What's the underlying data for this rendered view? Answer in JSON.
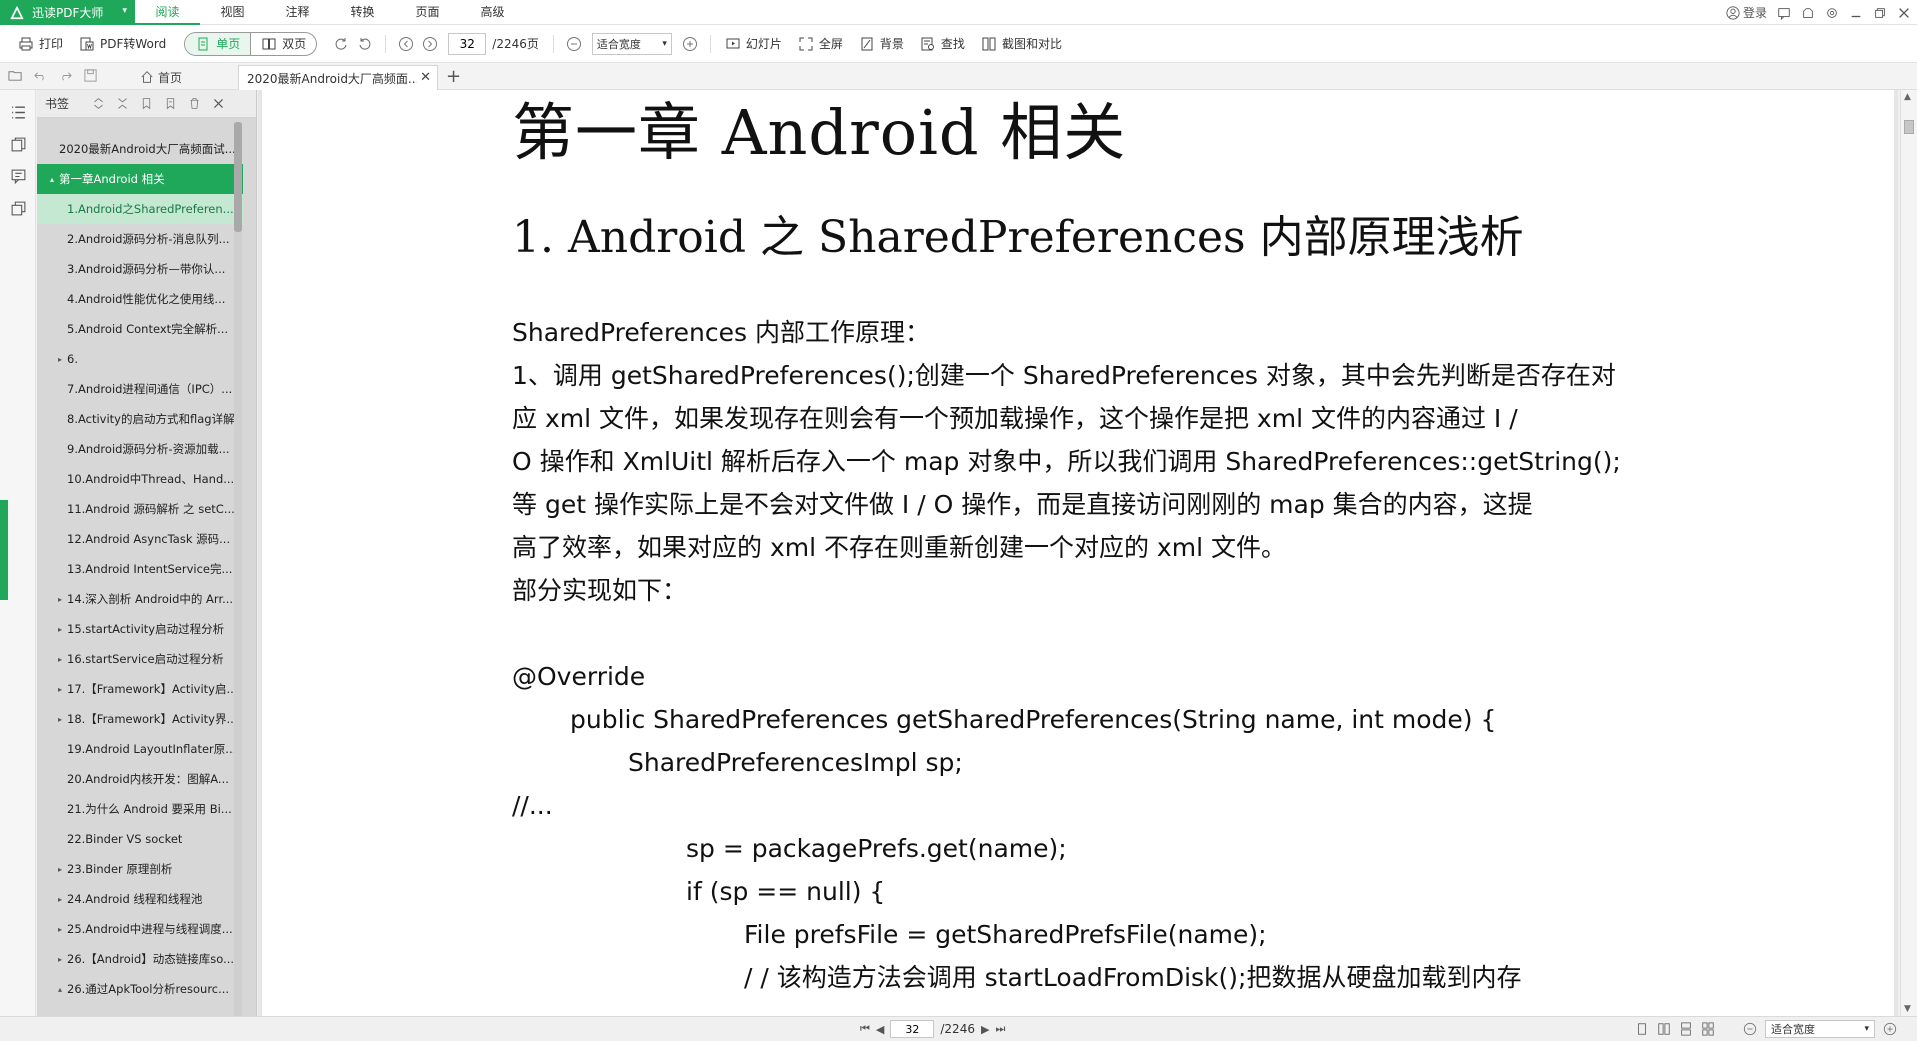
{
  "app": {
    "brand_label": "迅读PDF大师",
    "menu_tabs": [
      "阅读",
      "视图",
      "注释",
      "转换",
      "页面",
      "高级"
    ],
    "active_menu": "阅读",
    "login_label": "登录",
    "accent_color": "#1fa85a"
  },
  "toolbar": {
    "print_label": "打印",
    "pdf_to_word_label": "PDF转Word",
    "single_page_label": "单页",
    "double_page_label": "双页",
    "current_page": "32",
    "total_pages": "/2246页",
    "zoom_value": "适合宽度",
    "slideshow_label": "幻灯片",
    "fullscreen_label": "全屏",
    "background_label": "背景",
    "find_label": "查找",
    "crop_compare_label": "截图和对比"
  },
  "tabs": {
    "home_label": "首页",
    "doc_tab_title": "2020最新Android大厂高频面..."
  },
  "bookmarks": {
    "header_label": "书签",
    "items": [
      {
        "label": "2020最新Android大厂高频面试...",
        "level": 0,
        "arrow": ""
      },
      {
        "label": "第一章Android 相关",
        "level": 0,
        "arrow": "▴"
      },
      {
        "label": "1.Android之SharedPreferen...",
        "level": 1,
        "arrow": ""
      },
      {
        "label": "2.Android源码分析-消息队列...",
        "level": 1,
        "arrow": ""
      },
      {
        "label": "3.Android源码分析—带你认...",
        "level": 1,
        "arrow": ""
      },
      {
        "label": "4.Android性能优化之使用线...",
        "level": 1,
        "arrow": ""
      },
      {
        "label": "5.Android Context完全解析...",
        "level": 1,
        "arrow": ""
      },
      {
        "label": "6.",
        "level": 1,
        "arrow": "▸"
      },
      {
        "label": "7.Android进程间通信（IPC）...",
        "level": 1,
        "arrow": ""
      },
      {
        "label": "8.Activity的启动方式和flag详解",
        "level": 1,
        "arrow": ""
      },
      {
        "label": "9.Android源码分析-资源加载...",
        "level": 1,
        "arrow": ""
      },
      {
        "label": "10.Android中Thread、Hand...",
        "level": 1,
        "arrow": ""
      },
      {
        "label": "11.Android 源码解析 之 setC...",
        "level": 1,
        "arrow": ""
      },
      {
        "label": "12.Android AsyncTask 源码...",
        "level": 1,
        "arrow": ""
      },
      {
        "label": "13.Android IntentService完...",
        "level": 1,
        "arrow": ""
      },
      {
        "label": "14.深入剖析 Android中的 Arr...",
        "level": 1,
        "arrow": "▸"
      },
      {
        "label": "15.startActivity启动过程分析",
        "level": 1,
        "arrow": "▸"
      },
      {
        "label": "16.startService启动过程分析",
        "level": 1,
        "arrow": "▸"
      },
      {
        "label": "17.【Framework】Activity启...",
        "level": 1,
        "arrow": "▸"
      },
      {
        "label": "18.【Framework】Activity界...",
        "level": 1,
        "arrow": "▸"
      },
      {
        "label": "19.Android LayoutInflater原...",
        "level": 1,
        "arrow": ""
      },
      {
        "label": "20.Android内核开发：图解A...",
        "level": 1,
        "arrow": ""
      },
      {
        "label": "21.为什么 Android 要采用 Bi...",
        "level": 1,
        "arrow": ""
      },
      {
        "label": "22.Binder VS socket",
        "level": 1,
        "arrow": ""
      },
      {
        "label": "23.Binder 原理剖析",
        "level": 1,
        "arrow": "▸"
      },
      {
        "label": "24.Android 线程和线程池",
        "level": 1,
        "arrow": "▸"
      },
      {
        "label": "25.Android中进程与线程调度...",
        "level": 1,
        "arrow": "▸"
      },
      {
        "label": "26.【Android】动态链接库so...",
        "level": 1,
        "arrow": "▸"
      },
      {
        "label": "26.通过ApkTool分析resourc...",
        "level": 1,
        "arrow": "▴"
      }
    ]
  },
  "document": {
    "chapter_title": "第一章 Android 相关",
    "section_title": "1. Android 之 SharedPreferences 内部原理浅析",
    "paragraphs": [
      "SharedPreferences 内部工作原理：",
      "1、调用 getSharedPreferences();创建一个 SharedPreferences 对象，其中会先判断是否存在对",
      "应 xml 文件，如果发现存在则会有一个预加载操作，这个操作是把 xml 文件的内容通过 I /",
      "O 操作和 XmlUitl 解析后存入一个 map 对象中，所以我们调用 SharedPreferences::getString();",
      "等 get 操作实际上是不会对文件做 I / O 操作，而是直接访问刚刚的 map 集合的内容，这提",
      "高了效率，如果对应的 xml 不存在则重新创建一个对应的 xml 文件。",
      "部分实现如下："
    ],
    "code": [
      {
        "text": "@Override",
        "indent": 0
      },
      {
        "text": "public SharedPreferences getSharedPreferences(String name, int mode) {",
        "indent": 1
      },
      {
        "text": "SharedPreferencesImpl sp;",
        "indent": 2
      },
      {
        "text": "//...",
        "indent": 0
      },
      {
        "text": "sp = packagePrefs.get(name);",
        "indent": 3
      },
      {
        "text": "if (sp == null) {",
        "indent": 3
      },
      {
        "text": "File prefsFile = getSharedPrefsFile(name);",
        "indent": 4
      },
      {
        "text": "/ / 该构造方法会调用 startLoadFromDisk();把数据从硬盘加载到内存",
        "indent": 4
      }
    ]
  },
  "statusbar": {
    "current_page": "32",
    "total_pages": "/2246",
    "zoom_value": "适合宽度"
  }
}
